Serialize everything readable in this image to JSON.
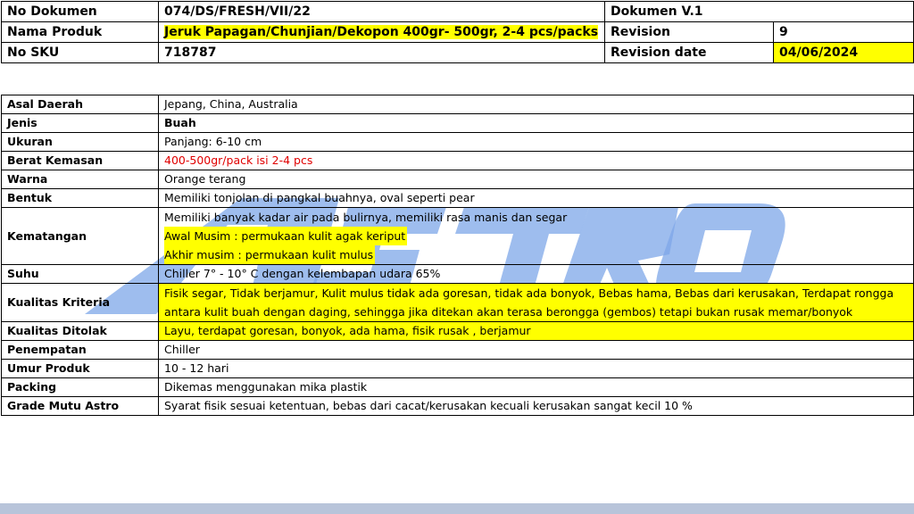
{
  "header": {
    "no_dokumen_label": "No Dokumen",
    "no_dokumen_value": "074/DS/FRESH/VII/22",
    "dokumen_version": "Dokumen V.1",
    "nama_produk_label": "Nama Produk",
    "nama_produk_value": "Jeruk Papagan/Chunjian/Dekopon 400gr- 500gr, 2-4 pcs/packs",
    "revision_label": "Revision",
    "revision_value": "9",
    "no_sku_label": "No SKU",
    "no_sku_value": "718787",
    "revision_date_label": "Revision date",
    "revision_date_value": "04/06/2024"
  },
  "spec": {
    "asal_label": "Asal Daerah",
    "asal_value": "Jepang, China, Australia",
    "jenis_label": "Jenis",
    "jenis_value": "Buah",
    "ukuran_label": "Ukuran",
    "ukuran_value": "Panjang: 6-10 cm",
    "berat_label": "Berat Kemasan",
    "berat_value": "400-500gr/pack isi 2-4 pcs",
    "warna_label": "Warna",
    "warna_value": "Orange terang",
    "bentuk_label": "Bentuk",
    "bentuk_value": "Memiliki tonjolan di pangkal buahnya,  oval seperti pear",
    "kematangan_label": "Kematangan",
    "kematangan_line1": "Memiliki banyak kadar air pada bulirnya, memiliki rasa manis dan segar",
    "kematangan_line2": "Awal Musim : permukaan kulit agak keriput",
    "kematangan_line3": "Akhir musim : permukaan kulit mulus",
    "suhu_label": "Suhu",
    "suhu_value": "Chiller 7° - 10° C dengan kelembapan udara 65%",
    "kriteria_label": "Kualitas Kriteria",
    "kriteria_value": "Fisik segar, Tidak berjamur, Kulit mulus tidak ada goresan, tidak ada bonyok, Bebas hama, Bebas dari kerusakan, Terdapat rongga antara kulit buah dengan daging, sehingga jika ditekan akan terasa berongga (gembos) tetapi bukan rusak memar/bonyok",
    "ditolak_label": "Kualitas Ditolak",
    "ditolak_value": "Layu, terdapat goresan, bonyok, ada hama, fisik rusak , berjamur",
    "penempatan_label": "Penempatan",
    "penempatan_value": "Chiller",
    "umur_label": "Umur Produk",
    "umur_value": "10 - 12 hari",
    "packing_label": "Packing",
    "packing_value": "Dikemas menggunakan mika plastik",
    "grade_label": "Grade Mutu Astro",
    "grade_value": "Syarat fisik sesuai ketentuan, bebas dari cacat/kerusakan kecuali kerusakan sangat kecil 10 %"
  },
  "watermark": {
    "text": "ASTRO",
    "color": "#7da7e8"
  },
  "colors": {
    "highlight": "#ffff00",
    "red_text": "#e00000",
    "bottom_band": "#b8c4da"
  }
}
